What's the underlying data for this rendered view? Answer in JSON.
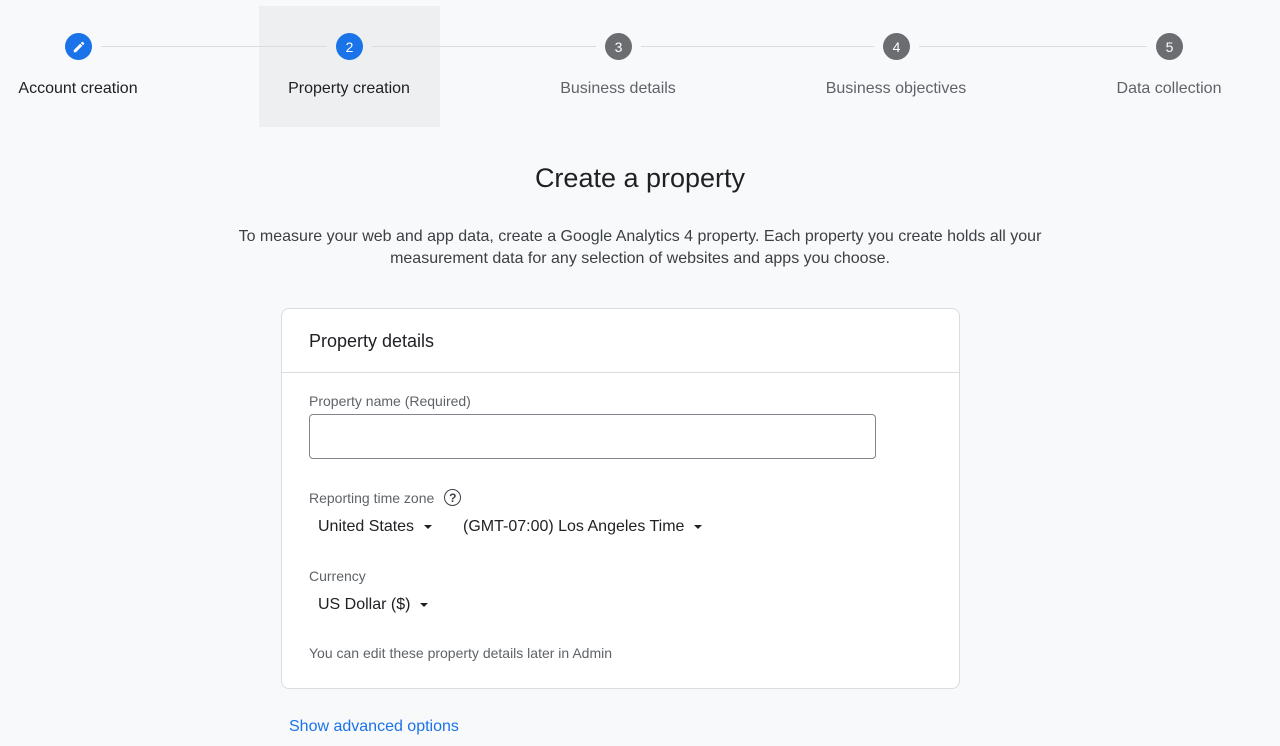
{
  "stepper": {
    "steps": [
      {
        "number": "",
        "label": "Account creation",
        "state": "completed",
        "icon": "pencil-icon"
      },
      {
        "number": "2",
        "label": "Property creation",
        "state": "active"
      },
      {
        "number": "3",
        "label": "Business details",
        "state": "upcoming"
      },
      {
        "number": "4",
        "label": "Business objectives",
        "state": "upcoming"
      },
      {
        "number": "5",
        "label": "Data collection",
        "state": "upcoming"
      }
    ]
  },
  "page": {
    "title": "Create a property",
    "description_line1": "To measure your web and app data, create a Google Analytics 4 property. Each property you create holds all your",
    "description_line2": "measurement data for any selection of websites and apps you choose."
  },
  "card": {
    "header": "Property details",
    "property_name_label": "Property name (Required)",
    "property_name_value": "",
    "timezone_label": "Reporting time zone",
    "country": "United States",
    "timezone": "(GMT-07:00) Los Angeles Time",
    "currency_label": "Currency",
    "currency": "US Dollar ($)",
    "hint": "You can edit these property details later in Admin"
  },
  "advanced_link": "Show advanced options",
  "colors": {
    "accent": "#1a73e8",
    "upcoming": "#6b6d70",
    "background": "#f8f9fb"
  }
}
